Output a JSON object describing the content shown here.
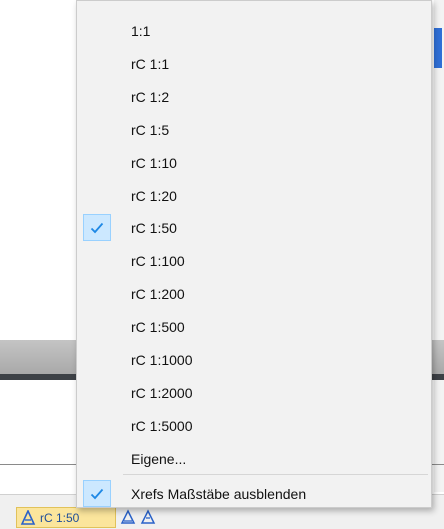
{
  "scale_menu": {
    "items": [
      {
        "label": "1:1",
        "checked": false
      },
      {
        "label": "rC 1:1",
        "checked": false
      },
      {
        "label": "rC 1:2",
        "checked": false
      },
      {
        "label": "rC 1:5",
        "checked": false
      },
      {
        "label": "rC 1:10",
        "checked": false
      },
      {
        "label": "rC 1:20",
        "checked": false
      },
      {
        "label": "rC 1:50",
        "checked": true
      },
      {
        "label": "rC 1:100",
        "checked": false
      },
      {
        "label": "rC 1:200",
        "checked": false
      },
      {
        "label": "rC 1:500",
        "checked": false
      },
      {
        "label": "rC 1:1000",
        "checked": false
      },
      {
        "label": "rC 1:2000",
        "checked": false
      },
      {
        "label": "rC 1:5000",
        "checked": false
      },
      {
        "label": "Eigene...",
        "checked": false
      }
    ],
    "hide_xref_scales": {
      "label": "Xrefs Maßstäbe ausblenden",
      "checked": true
    }
  },
  "status_bar": {
    "annotation_scale": "rC 1:50"
  },
  "colors": {
    "check_bg": "#cce8ff",
    "check_border": "#99d1ff",
    "check_mark": "#1e88e5",
    "status_scale_bg": "#fbe59c"
  }
}
